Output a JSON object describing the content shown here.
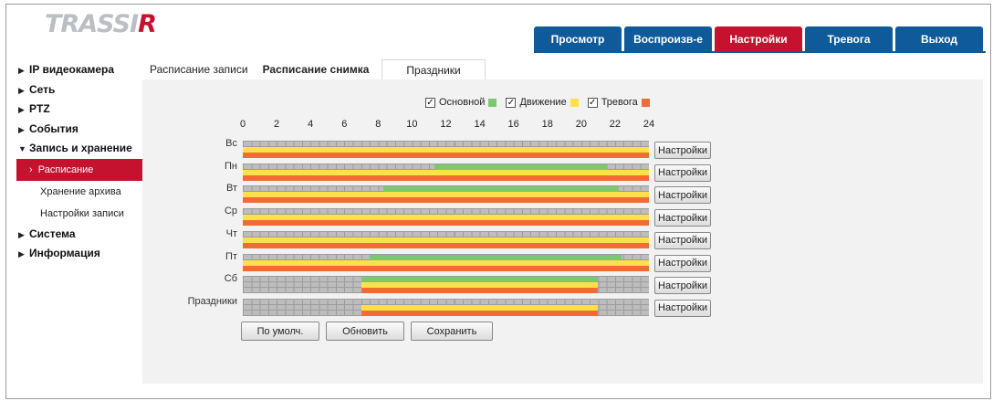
{
  "logo": {
    "text": "TRASSIR"
  },
  "topnav": [
    {
      "label": "Просмотр",
      "active": false
    },
    {
      "label": "Воспроизв-е",
      "active": false
    },
    {
      "label": "Настройки",
      "active": true
    },
    {
      "label": "Тревога",
      "active": false
    },
    {
      "label": "Выход",
      "active": false
    }
  ],
  "sidebar": {
    "items": [
      {
        "label": "IP видеокамера",
        "expanded": false
      },
      {
        "label": "Сеть",
        "expanded": false
      },
      {
        "label": "PTZ",
        "expanded": false
      },
      {
        "label": "События",
        "expanded": false
      },
      {
        "label": "Запись и хранение",
        "expanded": true
      }
    ],
    "subitems": [
      {
        "label": "Расписание",
        "active": true
      },
      {
        "label": "Хранение архива",
        "active": false
      },
      {
        "label": "Настройки записи",
        "active": false
      }
    ],
    "items_after": [
      {
        "label": "Система",
        "expanded": false
      },
      {
        "label": "Информация",
        "expanded": false
      }
    ]
  },
  "tabs": [
    {
      "label": "Расписание записи",
      "active": false
    },
    {
      "label": "Расписание снимка",
      "active": true
    },
    {
      "label": "Праздники",
      "active": false
    }
  ],
  "legend": [
    {
      "label": "Основной",
      "checked": true,
      "color": "#7dc76d"
    },
    {
      "label": "Движение",
      "checked": true,
      "color": "#ffe04a"
    },
    {
      "label": "Тревога",
      "checked": true,
      "color": "#f26b36"
    }
  ],
  "hours": [
    "0",
    "2",
    "4",
    "6",
    "8",
    "10",
    "12",
    "14",
    "16",
    "18",
    "20",
    "22",
    "24"
  ],
  "schedule": {
    "colors": {
      "regular": "#7dc76d",
      "motion": "#ffe04a",
      "alarm": "#f26b36"
    },
    "days": [
      {
        "label": "Вс",
        "regular": null,
        "motion": [
          0,
          24
        ],
        "alarm": [
          0,
          24
        ]
      },
      {
        "label": "Пн",
        "regular": [
          11.3,
          21.5
        ],
        "motion": [
          0,
          24
        ],
        "alarm": [
          0,
          24
        ]
      },
      {
        "label": "Вт",
        "regular": [
          8.3,
          22.2
        ],
        "motion": [
          0,
          24
        ],
        "alarm": [
          0,
          24
        ]
      },
      {
        "label": "Ср",
        "regular": null,
        "motion": [
          0,
          24
        ],
        "alarm": [
          0,
          24
        ]
      },
      {
        "label": "Чт",
        "regular": null,
        "motion": [
          0,
          24
        ],
        "alarm": [
          0,
          24
        ]
      },
      {
        "label": "Пт",
        "regular": [
          7.5,
          22.4
        ],
        "motion": [
          0,
          24
        ],
        "alarm": [
          0,
          24
        ]
      },
      {
        "label": "Сб",
        "regular": [
          7,
          21
        ],
        "motion": [
          7,
          21
        ],
        "alarm": [
          7,
          21
        ]
      },
      {
        "label": "Праздники",
        "regular": null,
        "motion": [
          7,
          21
        ],
        "alarm": [
          7,
          21
        ]
      }
    ],
    "settings_label": "Настройки"
  },
  "actions": {
    "default_label": "По умолч.",
    "refresh_label": "Обновить",
    "save_label": "Сохранить"
  }
}
